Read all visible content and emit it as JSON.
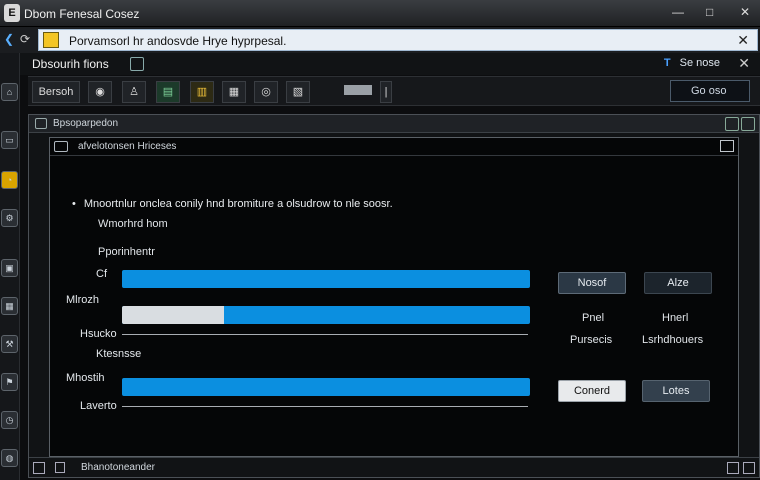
{
  "window": {
    "title": "Dbom Fenesal Cosez",
    "controls": [
      "—",
      "□",
      "✕"
    ]
  },
  "address": {
    "url": "Porvamsorl hr andosvde Hrye hyprpesal.",
    "close": "✕"
  },
  "header": {
    "title": "Dbsourih fions",
    "go_icon": "T",
    "go_label": "Se nose",
    "close": "✕"
  },
  "toolbar": {
    "first_label": "Bersoh",
    "search_label": "Go oso"
  },
  "panel": {
    "title": "Bpsoparpedon"
  },
  "dialog": {
    "title": "afvelotonsen Hriceses",
    "message": "Mnoortnlur onclea conily hnd bromiture a olsudrow to nle soosr.",
    "bullet": "•",
    "subtitle": "Wmorhrd hom",
    "section_label": "Pporinhentr",
    "rows": [
      {
        "label": "Cf",
        "fill": 0.0
      },
      {
        "label": "Mlrozh",
        "fill": 0.25
      },
      {
        "label": "Hsucko",
        "fill": null
      },
      {
        "label": "Ktesnsse",
        "fill": null
      },
      {
        "label": "Mhostih",
        "fill": 0.0
      },
      {
        "label": "Laverto",
        "fill": null
      }
    ],
    "buttons": {
      "primary": "Nosof",
      "secondary": "Alze",
      "confirm": "Conerd",
      "cancel": "Lotes"
    },
    "side_labels": {
      "left_top": "Pnel",
      "left_bottom": "Pursecis",
      "right_top": "Hnerl",
      "right_bottom": "Lsrhdhouers"
    },
    "status": "Bhanotoneander"
  }
}
